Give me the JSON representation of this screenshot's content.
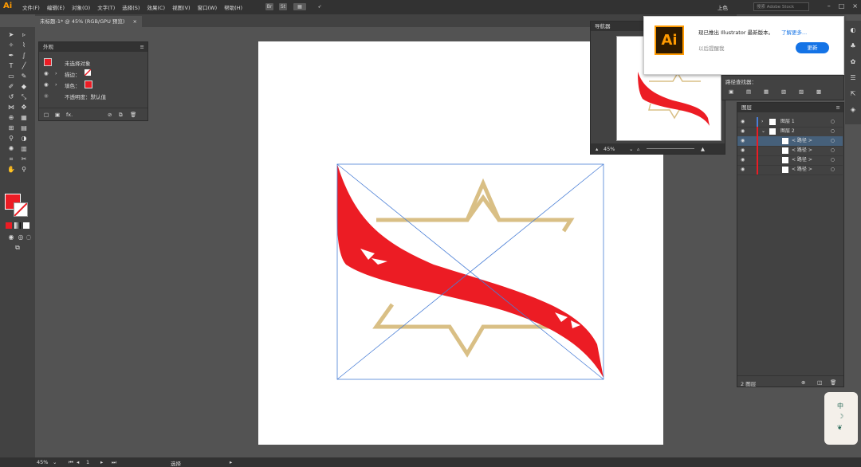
{
  "app": {
    "logo": "Ai"
  },
  "menu": [
    "文件(F)",
    "编辑(E)",
    "对象(O)",
    "文字(T)",
    "选择(S)",
    "效果(C)",
    "视图(V)",
    "窗口(W)",
    "帮助(H)"
  ],
  "toolbar_top": {
    "br": "Br",
    "st": "St",
    "workspace": "上色",
    "search_placeholder": "搜索 Adobe Stock"
  },
  "doc_tab": {
    "title": "未标题-1* @ 45% (RGB/GPU 预览)",
    "close": "×"
  },
  "appearance": {
    "title": "外观",
    "no_selection": "未选择对象",
    "stroke_label": "描边：",
    "fill_label": "填色：",
    "opacity": "不透明度：默认值",
    "fx": "fx."
  },
  "navigator": {
    "title": "导航器",
    "zoom": "45%"
  },
  "pathfinder": {
    "title": "路径查找器："
  },
  "layers": {
    "title": "图层",
    "items": [
      {
        "name": "图层 1",
        "indent": 0
      },
      {
        "name": "图层 2",
        "indent": 0
      },
      {
        "name": "< 路径 >",
        "indent": 1
      },
      {
        "name": "< 路径 >",
        "indent": 1
      },
      {
        "name": "< 路径 >",
        "indent": 1
      },
      {
        "name": "< 路径 >",
        "indent": 1
      }
    ],
    "count": "2 图层"
  },
  "notification": {
    "message": "现已推出 Illustrator 最新版本。",
    "link": "了解更多...",
    "later": "以后提醒我",
    "update": "更新",
    "logo": "Ai"
  },
  "status": {
    "zoom": "45%",
    "page": "1",
    "tool": "选择"
  },
  "badge": {
    "char": "中",
    "moon": "☽"
  },
  "colors": {
    "accent": "#ff9a00",
    "red": "#ec1c24",
    "gold": "#d9bf85",
    "guide": "#4a7fd6"
  }
}
